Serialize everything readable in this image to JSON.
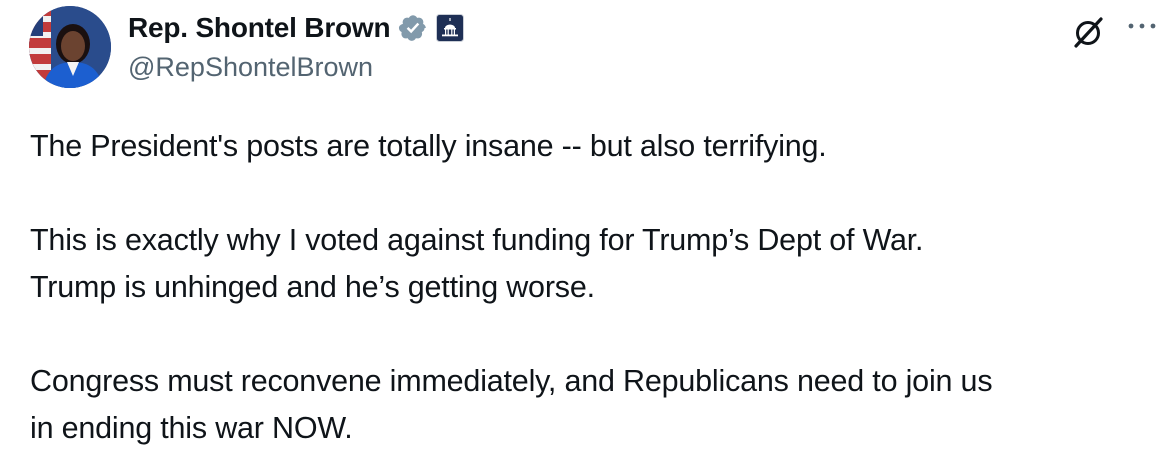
{
  "author": {
    "display_name": "Rep. Shontel Brown",
    "handle": "@RepShontelBrown",
    "verified": true,
    "badge_color": "#829aab",
    "affiliation_icon": "capitol-building-icon"
  },
  "actions": {
    "grok_icon": "grok-slash-icon",
    "more_icon": "more-dots-icon"
  },
  "tweet": {
    "lines": [
      "The President's posts are totally insane -- but also terrifying.",
      "",
      "This is exactly why I voted against funding for Trump’s Dept of War.",
      "Trump is unhinged and he’s getting worse.",
      "",
      "Congress must reconvene immediately, and Republicans need to join us",
      "in ending this war NOW."
    ]
  }
}
